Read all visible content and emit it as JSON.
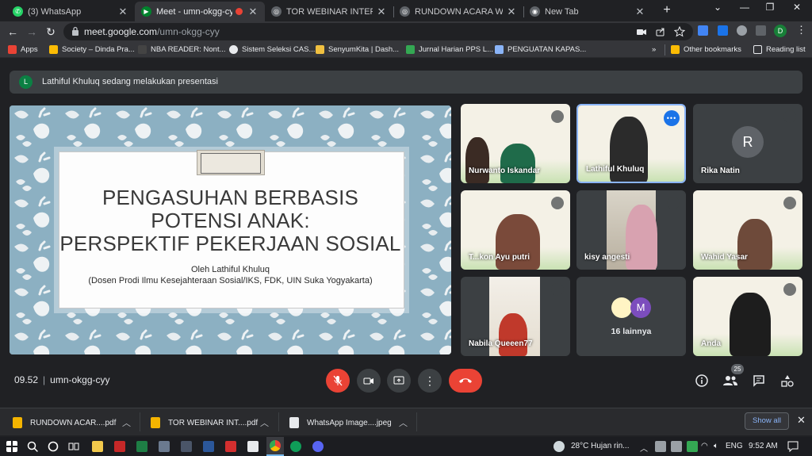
{
  "browser": {
    "tabs": [
      {
        "title": "(3) WhatsApp",
        "active": false
      },
      {
        "title": "Meet - umn-okgg-cyy",
        "active": true
      },
      {
        "title": "TOR WEBINAR INTERVENSI M",
        "active": false
      },
      {
        "title": "RUNDOWN ACARA WEBINAR",
        "active": false
      },
      {
        "title": "New Tab",
        "active": false
      }
    ],
    "url_host": "meet.google.com",
    "url_path": "/umn-okgg-cyy",
    "profile_initial": "D",
    "bookmarks": [
      "Apps",
      "Society – Dinda Pra...",
      "NBA READER: Nont...",
      "Sistem Seleksi CAS...",
      "SenyumKita | Dash...",
      "Jurnal Harian PPS L...",
      "PENGUATAN KAPAS..."
    ],
    "other_bookmarks": "Other bookmarks",
    "reading_list": "Reading list"
  },
  "meet": {
    "presenter_initial": "L",
    "banner_text": "Lathiful Khuluq sedang melakukan presentasi",
    "slide": {
      "title_line1": "PENGASUHAN BERBASIS",
      "title_line2": "POTENSI ANAK:",
      "title_line3": "PERSPEKTIF PEKERJAAN SOSIAL",
      "author": "Oleh Lathiful Khuluq",
      "affiliation": "(Dosen Prodi Ilmu Kesejahteraan Sosial/IKS, FDK, UIN Suka Yogyakarta)"
    },
    "participants": [
      {
        "name": "Nurwanto Iskandar"
      },
      {
        "name": "Lathiful Khuluq"
      },
      {
        "name": "Rika Natin",
        "initial": "R"
      },
      {
        "name": "T...kon Ayu putri"
      },
      {
        "name": "kisy angesti"
      },
      {
        "name": "Wahid Yasar"
      },
      {
        "name": "Nabila Queeen77"
      },
      {
        "name": "16 lainnya",
        "initial": "M"
      },
      {
        "name": "Anda"
      }
    ],
    "time": "09.52",
    "meeting_code": "umn-okgg-cyy",
    "people_count": "25"
  },
  "downloads": [
    {
      "name": "RUNDOWN ACAR....pdf"
    },
    {
      "name": "TOR WEBINAR INT....pdf"
    },
    {
      "name": "WhatsApp Image....jpeg"
    }
  ],
  "show_all": "Show all",
  "taskbar": {
    "weather": "28°C  Hujan rin...",
    "lang": "ENG",
    "clock": "9:52 AM"
  },
  "colors": {
    "accent_red": "#ea4335",
    "meet_bg": "#202124",
    "link_blue": "#8ab4f8"
  }
}
